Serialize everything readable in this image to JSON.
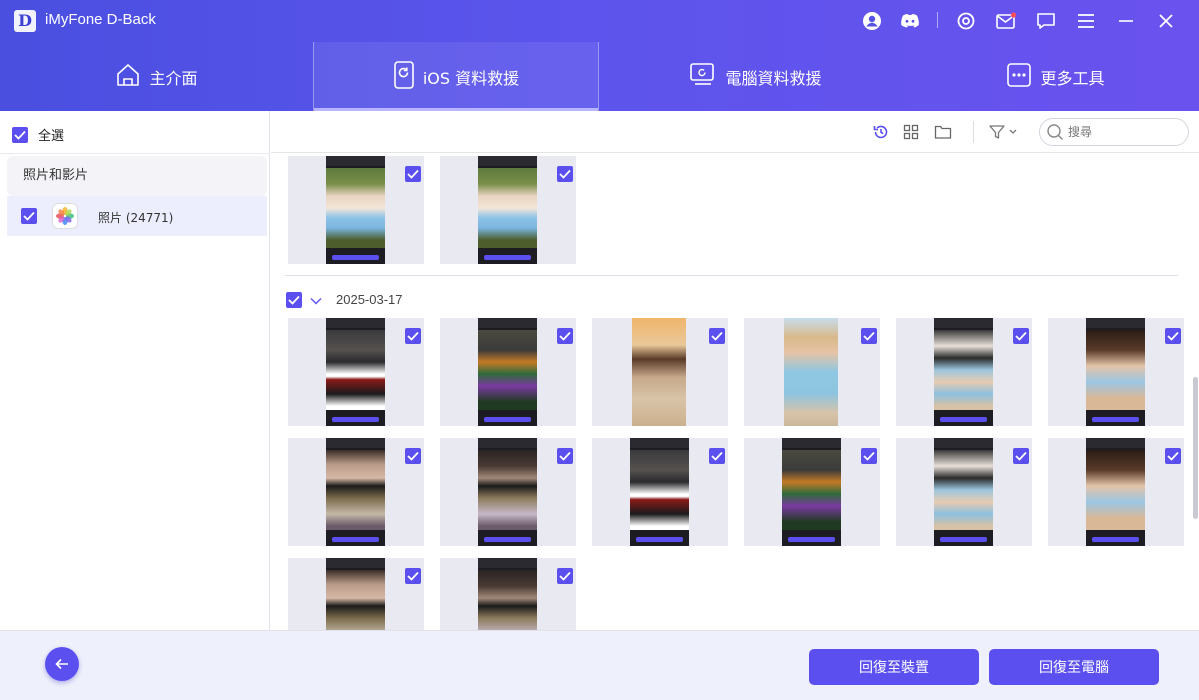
{
  "app": {
    "title": "iMyFone D-Back",
    "logo_letter": "D"
  },
  "titlebar_icons": [
    "user-icon",
    "discord-icon",
    "settings-icon",
    "mail-icon",
    "chat-icon",
    "menu-icon",
    "minimize-icon",
    "close-icon"
  ],
  "tabs": [
    {
      "label": "主介面",
      "icon": "home-icon",
      "active": false
    },
    {
      "label": "iOS 資料救援",
      "icon": "ios-recovery-icon",
      "active": true
    },
    {
      "label": "電腦資料救援",
      "icon": "pc-recovery-icon",
      "active": false
    },
    {
      "label": "更多工具",
      "icon": "more-tools-icon",
      "active": false
    }
  ],
  "sidebar": {
    "select_all_label": "全選",
    "category_header": "照片和影片",
    "items": [
      {
        "label": "照片 (24771)",
        "checked": true
      }
    ]
  },
  "toolbar": {
    "icons": [
      "history-icon",
      "grid-view-icon",
      "folder-icon",
      "filter-icon"
    ],
    "search_placeholder": "搜尋"
  },
  "content": {
    "groups": [
      {
        "date": "",
        "thumb_count": 2
      },
      {
        "date": "2025-03-17",
        "thumb_count": 14
      }
    ]
  },
  "footer": {
    "restore_device_label": "回復至裝置",
    "restore_pc_label": "回復至電腦"
  },
  "colors": {
    "accent": "#5b4ff0",
    "header_start": "#4a4fe0",
    "header_end": "#6a52ee"
  }
}
